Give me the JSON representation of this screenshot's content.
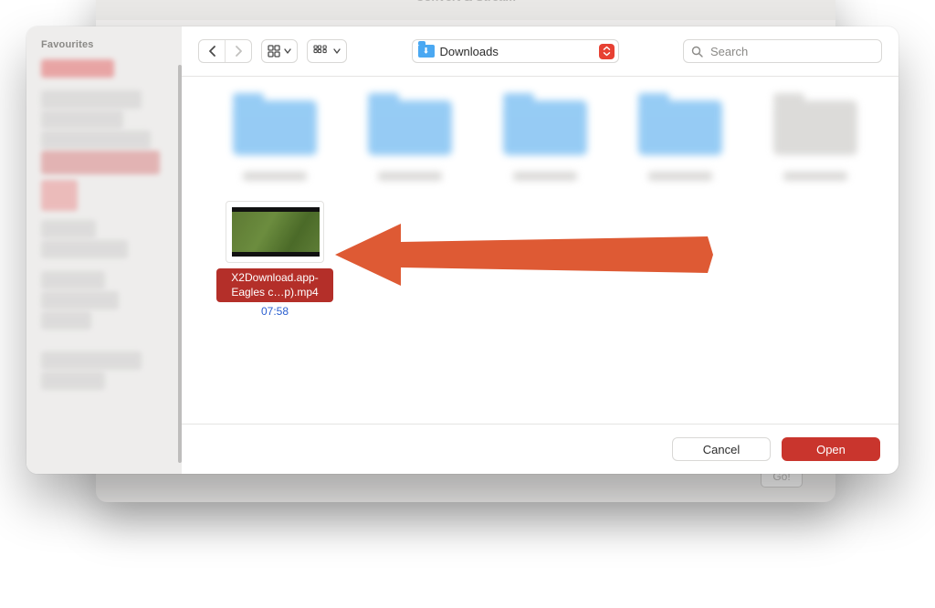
{
  "parent_window": {
    "title": "Convert & Stream",
    "go_button": "Go!"
  },
  "sidebar": {
    "heading": "Favourites"
  },
  "toolbar": {
    "location_label": "Downloads",
    "search_placeholder": "Search"
  },
  "files": {
    "selected_video": {
      "name": "X2Download.app-Eagles c…p).mp4",
      "duration": "07:58"
    }
  },
  "footer": {
    "cancel": "Cancel",
    "open": "Open"
  }
}
